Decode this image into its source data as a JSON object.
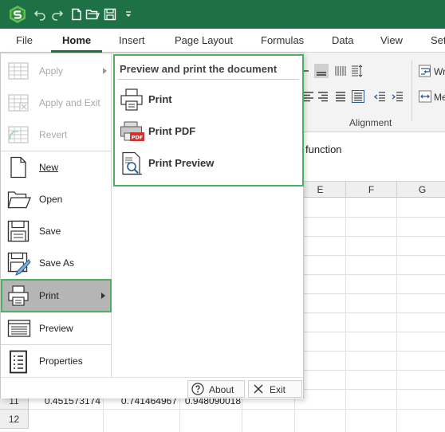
{
  "colors": {
    "title_bar": "#1e7145",
    "highlight_border": "#4caf64",
    "selected_item": "#b5b5b5"
  },
  "title_bar": {
    "icons": [
      "app-logo-icon",
      "undo-icon",
      "redo-icon",
      "new-file-icon",
      "open-folder-icon",
      "save-icon",
      "customize-toolbar-icon"
    ]
  },
  "ribbon": {
    "tabs": [
      "File",
      "Home",
      "Insert",
      "Page Layout",
      "Formulas",
      "Data",
      "View",
      "Set"
    ],
    "active_tab": "Home",
    "visible_group": {
      "label": "Alignment",
      "wrap_text_label": "Wra",
      "merge_label": "Me"
    }
  },
  "formula_bar": {
    "text": "function"
  },
  "grid": {
    "column_headers": [
      "E",
      "F",
      "G"
    ],
    "row_headers": [
      "11",
      "12"
    ],
    "row11_values": [
      "0.451573174",
      "0.741464967",
      "0.948090018"
    ]
  },
  "backstage": {
    "items": [
      {
        "label": "Apply",
        "icon": "apply-icon",
        "enabled": false,
        "submenu": true
      },
      {
        "label": "Apply and Exit",
        "icon": "apply-exit-icon",
        "enabled": false,
        "submenu": false
      },
      {
        "label": "Revert",
        "icon": "revert-icon",
        "enabled": false,
        "submenu": false
      },
      {
        "label": "New",
        "icon": "new-document-icon",
        "enabled": true,
        "submenu": false
      },
      {
        "label": "Open",
        "icon": "open-folder-icon",
        "enabled": true,
        "submenu": false
      },
      {
        "label": "Save",
        "icon": "save-icon",
        "enabled": true,
        "submenu": false
      },
      {
        "label": "Save As",
        "icon": "save-as-icon",
        "enabled": true,
        "submenu": false
      },
      {
        "label": "Print",
        "icon": "printer-icon",
        "enabled": true,
        "submenu": true,
        "active": true
      },
      {
        "label": "Preview",
        "icon": "preview-icon",
        "enabled": true,
        "submenu": false
      },
      {
        "label": "Properties",
        "icon": "properties-icon",
        "enabled": true,
        "submenu": false
      }
    ],
    "print_submenu": {
      "title": "Preview and print the document",
      "items": [
        {
          "label": "Print",
          "icon": "printer-icon"
        },
        {
          "label": "Print PDF",
          "icon": "pdf-printer-icon"
        },
        {
          "label": "Print Preview",
          "icon": "print-preview-icon"
        }
      ]
    },
    "bottom_buttons": [
      {
        "label": "About",
        "icon": "help-icon"
      },
      {
        "label": "Exit",
        "icon": "close-icon"
      }
    ]
  }
}
